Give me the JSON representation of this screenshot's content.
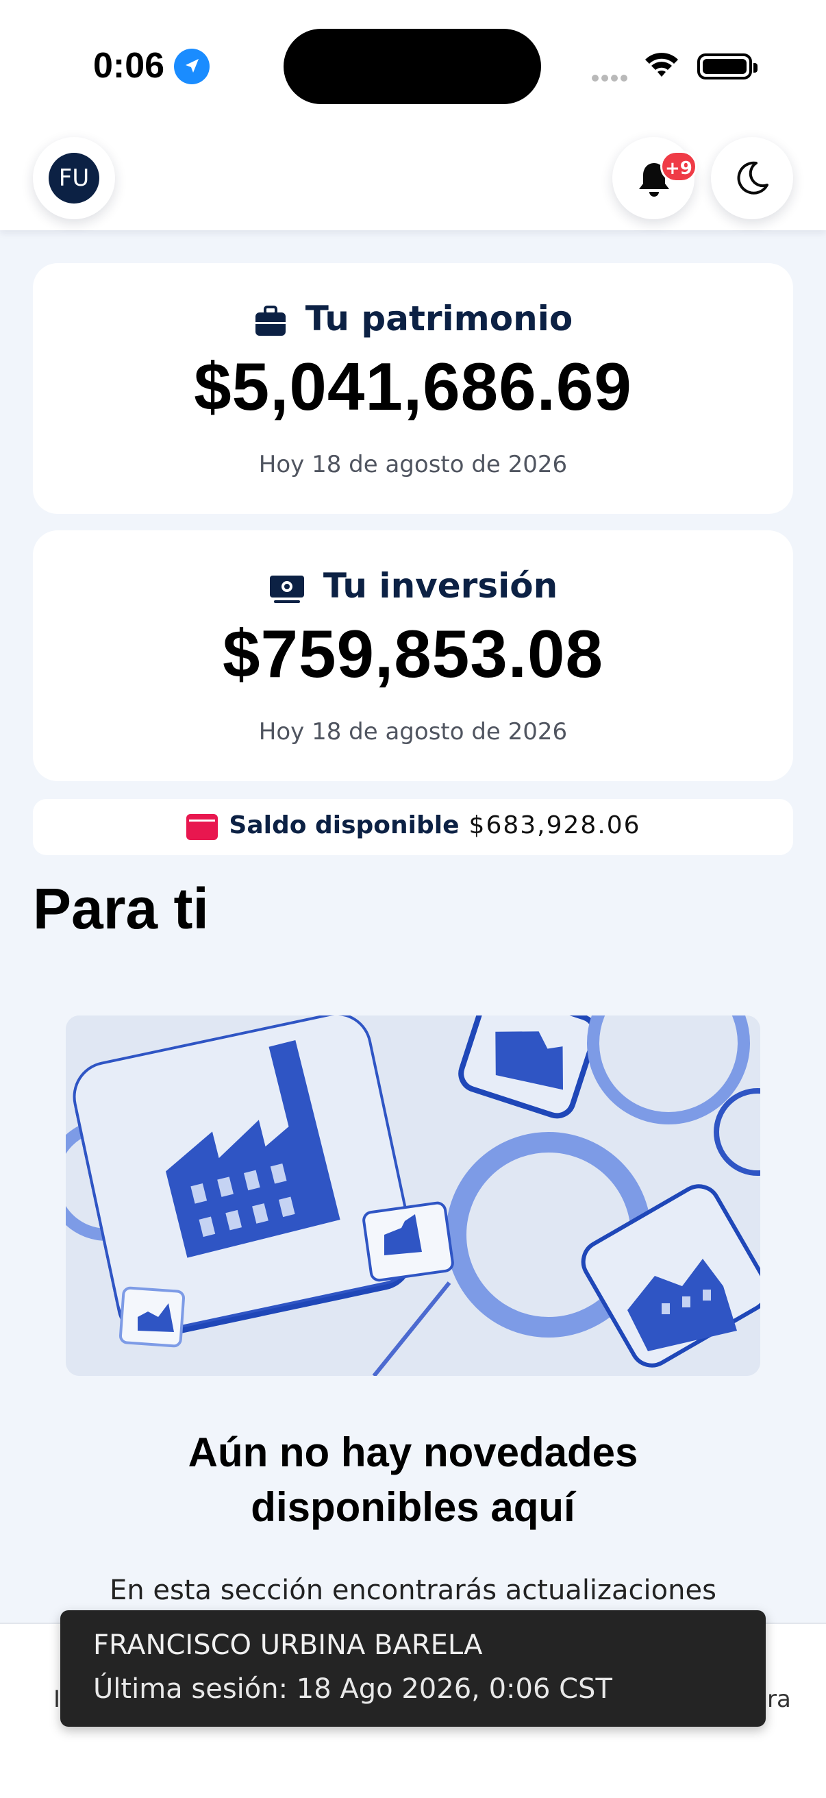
{
  "status_bar": {
    "time": "0:06"
  },
  "header": {
    "avatar_initials": "FU",
    "notification_badge": "+9"
  },
  "patrimonio": {
    "title": "Tu patrimonio",
    "amount": "$5,041,686.69",
    "date": "Hoy 18 de agosto de 2026"
  },
  "inversion": {
    "title": "Tu inversión",
    "amount": "$759,853.08",
    "date": "Hoy 18 de agosto de 2026"
  },
  "saldo": {
    "label": "Saldo disponible",
    "value": "$683,928.06"
  },
  "para_ti": {
    "title": "Para ti",
    "empty_title_line1": "Aún no hay novedades",
    "empty_title_line2": "disponibles aquí",
    "empty_desc": "En esta sección encontrarás actualizaciones"
  },
  "bottom_edge": {
    "left_char": "I",
    "right_chars": "ra"
  },
  "toast": {
    "name": "FRANCISCO URBINA BARELA",
    "session": "Última sesión: 18 Ago 2026, 0:06 CST"
  },
  "colors": {
    "navy": "#0c2144",
    "badge_red": "#ef3b46",
    "wallet_pink": "#e8174f",
    "illustration_blue": "#2f55c4",
    "background": "#f1f5fb"
  },
  "icons": [
    "location-arrow-icon",
    "wifi-icon",
    "battery-icon",
    "bell-icon",
    "moon-icon",
    "briefcase-icon",
    "cash-icon",
    "wallet-icon"
  ]
}
